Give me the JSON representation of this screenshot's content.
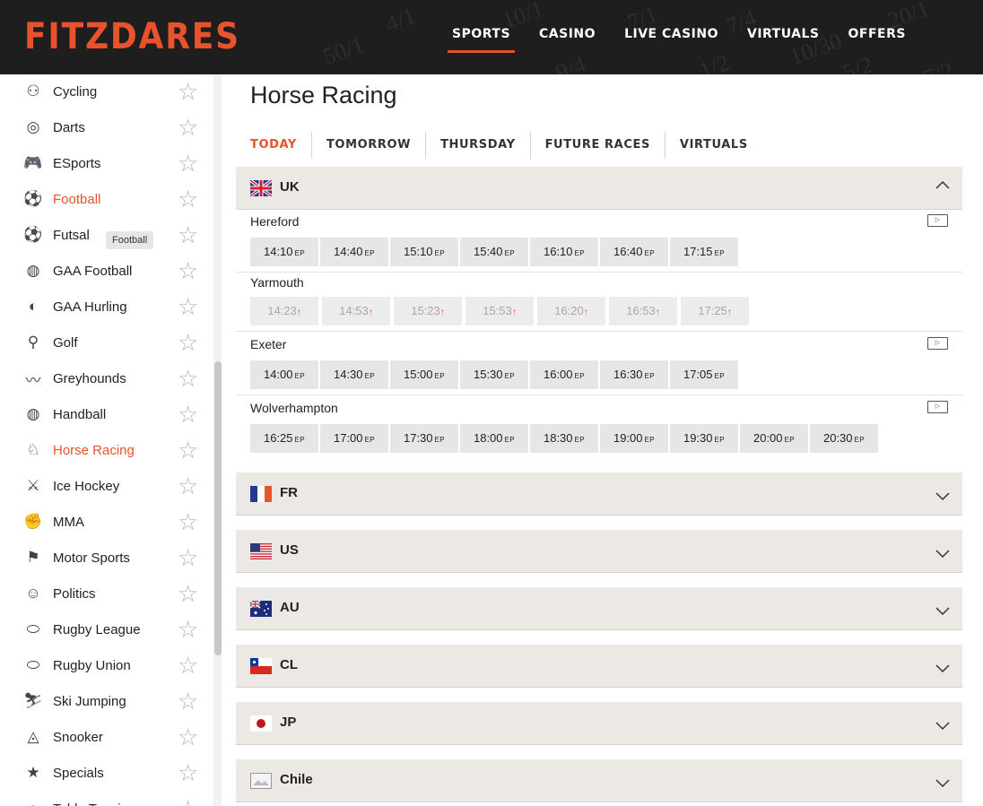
{
  "header": {
    "logo": "FITZDARES",
    "nav": [
      "SPORTS",
      "CASINO",
      "LIVE CASINO",
      "VIRTUALS",
      "OFFERS"
    ],
    "active_nav": "SPORTS",
    "bg_odds": [
      "10/1",
      "7/1",
      "9/4",
      "7/4",
      "10/30",
      "20/1",
      "50/1",
      "5/2",
      "7/2",
      "1/2",
      "4/1"
    ]
  },
  "sidebar": {
    "tooltip": "Football",
    "items": [
      {
        "label": "Cycling",
        "icon": "cycling-icon",
        "glyph": "⚇"
      },
      {
        "label": "Darts",
        "icon": "darts-icon",
        "glyph": "◎"
      },
      {
        "label": "ESports",
        "icon": "gamepad-icon",
        "glyph": "🎮"
      },
      {
        "label": "Football",
        "icon": "football-icon",
        "glyph": "⚽"
      },
      {
        "label": "Futsal",
        "icon": "futsal-icon",
        "glyph": "⚽"
      },
      {
        "label": "GAA Football",
        "icon": "gaa-football-icon",
        "glyph": "◍"
      },
      {
        "label": "GAA Hurling",
        "icon": "gaa-hurling-icon",
        "glyph": "◐"
      },
      {
        "label": "Golf",
        "icon": "golf-icon",
        "glyph": "⚲"
      },
      {
        "label": "Greyhounds",
        "icon": "greyhound-icon",
        "glyph": "〰"
      },
      {
        "label": "Handball",
        "icon": "handball-icon",
        "glyph": "◍"
      },
      {
        "label": "Horse Racing",
        "icon": "horse-racing-icon",
        "glyph": "♘"
      },
      {
        "label": "Ice Hockey",
        "icon": "ice-hockey-icon",
        "glyph": "⚔"
      },
      {
        "label": "MMA",
        "icon": "mma-glove-icon",
        "glyph": "✊"
      },
      {
        "label": "Motor Sports",
        "icon": "checkered-flag-icon",
        "glyph": "⚑"
      },
      {
        "label": "Politics",
        "icon": "politics-icon",
        "glyph": "☺"
      },
      {
        "label": "Rugby League",
        "icon": "rugby-league-icon",
        "glyph": "⬭"
      },
      {
        "label": "Rugby Union",
        "icon": "rugby-union-icon",
        "glyph": "⬭"
      },
      {
        "label": "Ski Jumping",
        "icon": "ski-jumping-icon",
        "glyph": "⛷"
      },
      {
        "label": "Snooker",
        "icon": "snooker-icon",
        "glyph": "◬"
      },
      {
        "label": "Specials",
        "icon": "specials-star-icon",
        "glyph": "★"
      },
      {
        "label": "Table Tennis",
        "icon": "table-tennis-icon",
        "glyph": "●"
      }
    ],
    "highlighted": [
      "Football",
      "Horse Racing"
    ]
  },
  "main": {
    "title": "Horse Racing",
    "tabs": [
      "TODAY",
      "TOMORROW",
      "THURSDAY",
      "FUTURE RACES",
      "VIRTUALS"
    ],
    "active_tab": "TODAY",
    "uk": {
      "label": "UK",
      "watch_label": "▷",
      "meetings": [
        {
          "name": "Hereford",
          "watch": true,
          "suspended": false,
          "times": [
            "14:10",
            "14:40",
            "15:10",
            "15:40",
            "16:10",
            "16:40",
            "17:15"
          ]
        },
        {
          "name": "Yarmouth",
          "watch": false,
          "suspended": true,
          "times": [
            "14:23",
            "14:53",
            "15:23",
            "15:53",
            "16:20",
            "16:53",
            "17:25"
          ]
        },
        {
          "name": "Exeter",
          "watch": true,
          "suspended": false,
          "times": [
            "14:00",
            "14:30",
            "15:00",
            "15:30",
            "16:00",
            "16:30",
            "17:05"
          ]
        },
        {
          "name": "Wolverhampton",
          "watch": true,
          "suspended": false,
          "times": [
            "16:25",
            "17:00",
            "17:30",
            "18:00",
            "18:30",
            "19:00",
            "19:30",
            "20:00",
            "20:30"
          ]
        }
      ],
      "ep": "EP",
      "arrow": "↑"
    },
    "regions": [
      {
        "label": "FR",
        "flag": "france-flag-icon"
      },
      {
        "label": "US",
        "flag": "us-flag-icon"
      },
      {
        "label": "AU",
        "flag": "australia-flag-icon"
      },
      {
        "label": "CL",
        "flag": "chile-flag-icon"
      },
      {
        "label": "JP",
        "flag": "japan-flag-icon"
      },
      {
        "label": "Chile",
        "flag": "broken-image-icon"
      }
    ]
  },
  "colors": {
    "accent": "#e8532b",
    "header_bg": "#1e1e1e",
    "region_bg": "#ece8e4"
  }
}
